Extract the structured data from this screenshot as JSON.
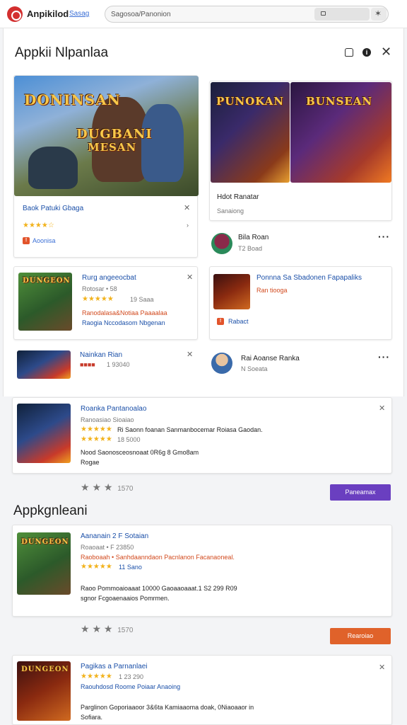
{
  "topbar": {
    "brand_name": "Anpikilod",
    "brand_sub": "Sasag",
    "search_value": "Sagosoa/Panonion"
  },
  "panel": {
    "title": "Appkii Nlpanlaa",
    "hero_logo_1": "DONINSAN",
    "hero_logo_2": "DUGBANI",
    "hero_logo_3": "MESAN",
    "featured": {
      "title": "Baok Patuki Gbaga",
      "rating_stars": "★★★★☆",
      "tag": "Aoonisa"
    },
    "promo": {
      "logo_left": "PUNOKAN",
      "logo_right": "BUNSEAN",
      "title": "Hdot Ranatar",
      "subtitle": "Sanaiong"
    },
    "account_1": {
      "name": "Bila Roan",
      "sub": "T2 Boad"
    },
    "game_card_1": {
      "title": "Rurg angeeocbat",
      "sub": "Rotosar • 58",
      "rating_stars": "★★★★★",
      "rating_value": "19 Saaa",
      "desc_1": "Ranodalasa&Notiaa Paaaalaa",
      "desc_2": "Raogia Nccodasom Nbgenan"
    },
    "game_card_2": {
      "title": "Ponnna Sa Sbadonen Fapapaliks",
      "sub": "Ran tiooga",
      "tag": "Rabact"
    },
    "game_small": {
      "title": "Nainkan Rian",
      "rating_stars": "■■■■",
      "rating_value": "1 93040"
    },
    "account_2": {
      "name": "Rai Aoanse Ranka",
      "sub": "N Soeata"
    }
  },
  "list": [
    {
      "title": "Roanka Pantanoalao",
      "sub": "Ranoasiao Sioaiao",
      "rating_1": "★★★★★",
      "line_1": "Ri Saonn foanan Sanmanbocemar Roiasa Gaodan.",
      "rating_2": "★★★★★",
      "line_2": "18 5000",
      "desc_1": "Nood Saonosceosnoaat 0R6g 8 Gmo8am",
      "desc_2": "Rogae",
      "meta_stars": "★ ★ ★",
      "meta_count": "1570",
      "button": "Paneamax"
    },
    {
      "title": "Aananain 2 F Sotaian",
      "sub": "Roaoaat • F 23850",
      "line_1": "Raoboaah • Sanhdaanndaon Pacnlanon Facanaoneal.",
      "rating_1": "★★★★★",
      "line_2": "11 Sano",
      "desc_1": "Raoo Pommoaioaaat 10000 Gaoaaoaaat.1 S2 299 R09",
      "desc_2": "sgnor Fcgoaenaaios Pomrmen.",
      "meta_stars": "★ ★ ★",
      "meta_count": "1570",
      "button": "Rearoiao"
    },
    {
      "title": "Pagikas a Parnanlaei",
      "rating_1": "★★★★★",
      "line_1": "1 23 290",
      "line_2": "Raouhdosd Roome Poiaar Anaoing",
      "desc_1": "Parglinon Goporiaaoor 3&6ta Kamiaaoma doak, 0Niaoaaor in",
      "desc_2": "Sofiara."
    }
  ],
  "section_2_title": "Appkgnleani",
  "colors": {
    "accent_purple": "#6a3fc0",
    "accent_orange": "#e0622a",
    "brand_red": "#d32f2f",
    "title_blue": "#1a4fa8",
    "star_yellow": "#f2b21b"
  }
}
